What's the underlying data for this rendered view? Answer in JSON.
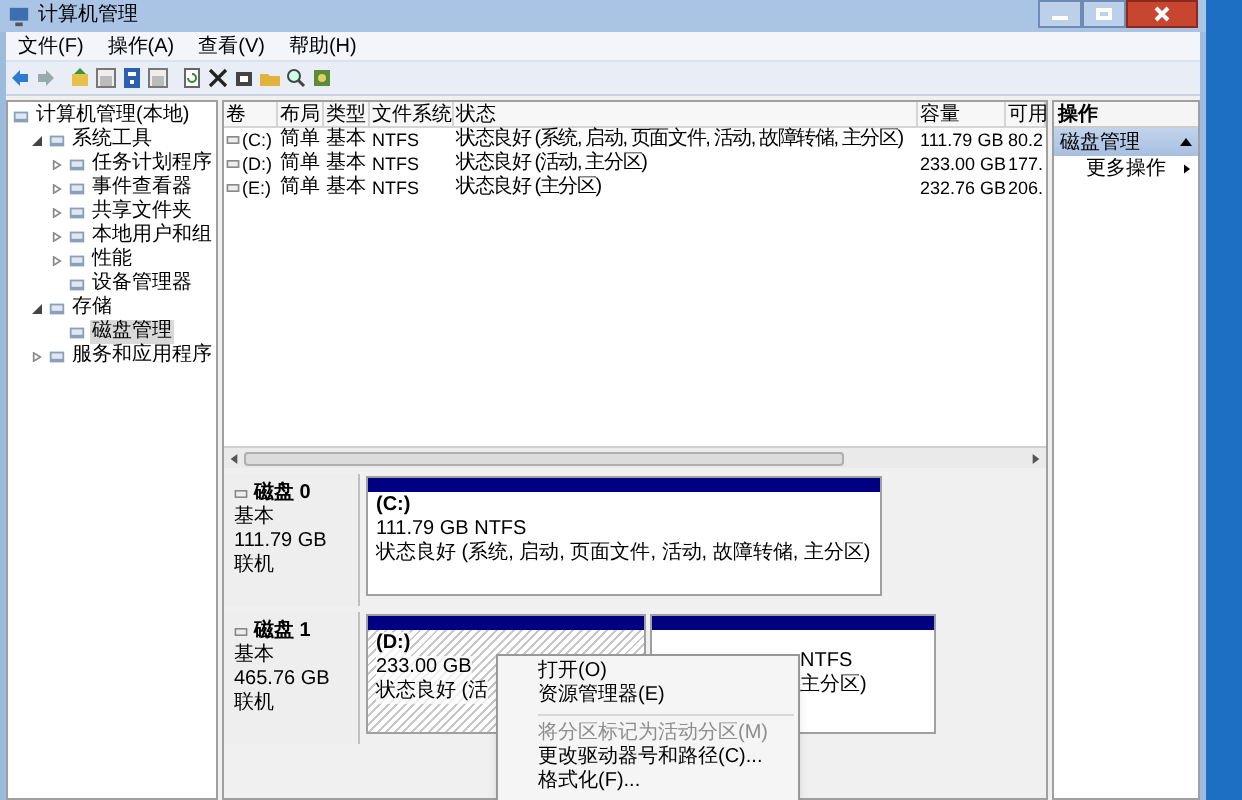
{
  "window": {
    "title": "计算机管理"
  },
  "menu": [
    "文件(F)",
    "操作(A)",
    "查看(V)",
    "帮助(H)"
  ],
  "tree": [
    {
      "label": "计算机管理(本地)",
      "selected": false,
      "children": [
        {
          "label": "系统工具",
          "expanded": true,
          "selected": false,
          "children": [
            {
              "label": "任务计划程序",
              "expanded": false,
              "selected": false
            },
            {
              "label": "事件查看器",
              "expanded": false,
              "selected": false
            },
            {
              "label": "共享文件夹",
              "expanded": false,
              "selected": false
            },
            {
              "label": "本地用户和组",
              "expanded": false,
              "selected": false
            },
            {
              "label": "性能",
              "expanded": false,
              "selected": false
            },
            {
              "label": "设备管理器",
              "selected": false
            }
          ]
        },
        {
          "label": "存储",
          "expanded": true,
          "selected": false,
          "children": [
            {
              "label": "磁盘管理",
              "selected": true
            }
          ]
        },
        {
          "label": "服务和应用程序",
          "expanded": false,
          "selected": false
        }
      ]
    }
  ],
  "table": {
    "columns": [
      "卷",
      "布局",
      "类型",
      "文件系统",
      "状态",
      "容量",
      "可用"
    ],
    "rows": [
      [
        "(C:)",
        "简单",
        "基本",
        "NTFS",
        "状态良好 (系统, 启动, 页面文件, 活动, 故障转储, 主分区)",
        "111.79 GB",
        "80.2"
      ],
      [
        "(D:)",
        "简单",
        "基本",
        "NTFS",
        "状态良好 (活动, 主分区)",
        "233.00 GB",
        "177."
      ],
      [
        "(E:)",
        "简单",
        "基本",
        "NTFS",
        "状态良好 (主分区)",
        "232.76 GB",
        "206."
      ]
    ]
  },
  "disks": [
    {
      "name": "磁盘 0",
      "type": "基本",
      "size": "111.79 GB",
      "state": "联机",
      "partitions": [
        {
          "lines": [
            "(C:)",
            "111.79 GB NTFS",
            "状态良好 (系统, 启动, 页面文件, 活动, 故障转储, 主分区)"
          ],
          "selected": false,
          "covered": false
        }
      ]
    },
    {
      "name": "磁盘 1",
      "type": "基本",
      "size": "465.76 GB",
      "state": "联机",
      "partitions": [
        {
          "lines": [
            "(D:)",
            "233.00 GB",
            "状态良好 (活"
          ],
          "selected": true,
          "covered": false
        },
        {
          "lines": [
            "NTFS",
            "主分区)"
          ],
          "selected": false,
          "covered": true
        }
      ]
    }
  ],
  "actions": {
    "title": "操作",
    "section": "磁盘管理",
    "items": [
      "更多操作"
    ]
  },
  "context_menu": [
    {
      "label": "打开(O)",
      "disabled": false
    },
    {
      "label": "资源管理器(E)",
      "disabled": false
    },
    {
      "kind": "separator"
    },
    {
      "label": "将分区标记为活动分区(M)",
      "disabled": true
    },
    {
      "label": "更改驱动器号和路径(C)...",
      "disabled": false
    },
    {
      "label": "格式化(F)...",
      "disabled": false
    }
  ]
}
